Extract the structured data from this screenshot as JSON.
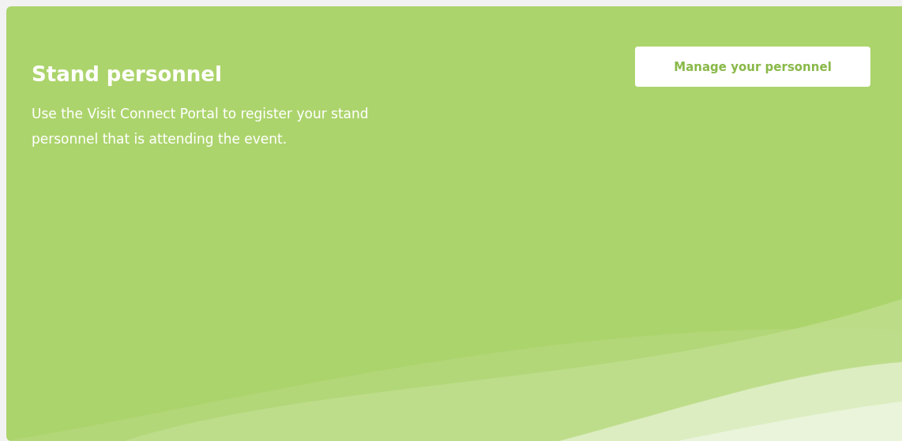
{
  "card": {
    "title": "Stand personnel",
    "description": "Use the Visit Connect Portal to register your stand personnel that is attending the event.",
    "button": "Manage your personnel"
  }
}
